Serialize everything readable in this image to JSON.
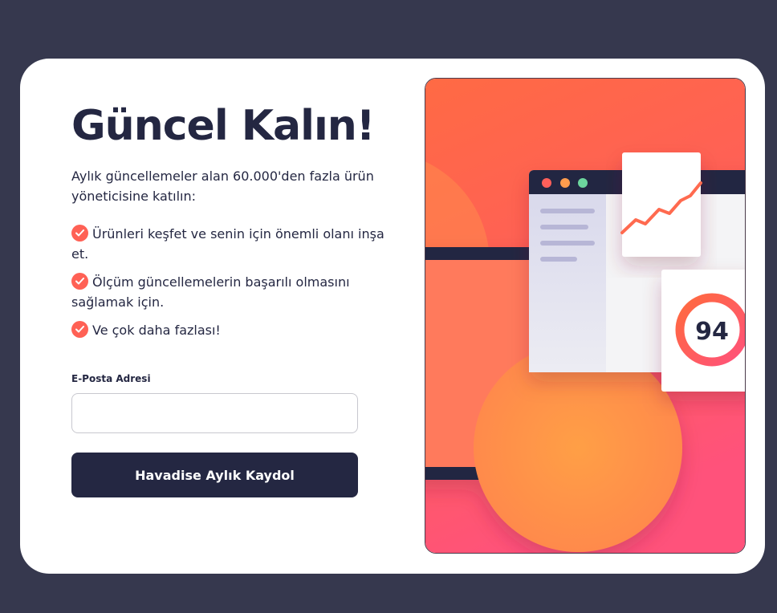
{
  "signup": {
    "title": "Güncel Kalın!",
    "intro": "Aylık güncellemeler alan 60.000'den fazla ürün yöneticisine katılın:",
    "features": [
      "Ürünleri keşfet ve senin için önemli olanı inşa et.",
      "Ölçüm güncellemelerin başarılı olmasını sağlamak için.",
      "Ve çok daha fazlası!"
    ],
    "email_label": "E-Posta Adresi",
    "email_value": "",
    "email_placeholder": "",
    "submit_label": "Havadise Aylık Kaydol"
  },
  "illustration": {
    "score": "94",
    "icons": [
      "check-icon",
      "window-dots",
      "line-graph",
      "score-ring"
    ],
    "colors": {
      "accent": "#ff6155",
      "dark": "#242742",
      "gradient_top": "#ff6a3d",
      "gradient_bottom": "#ff527b",
      "page_bg": "#36384e"
    }
  }
}
